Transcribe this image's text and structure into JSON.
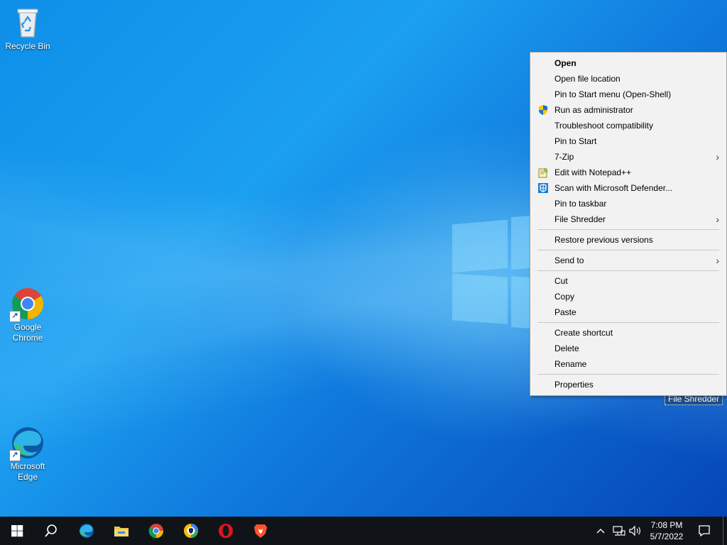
{
  "desktop": {
    "icons": [
      {
        "label": "Recycle Bin"
      },
      {
        "label_line1": "Google",
        "label_line2": "Chrome"
      },
      {
        "label_line1": "Microsoft",
        "label_line2": "Edge"
      }
    ]
  },
  "context_menu": {
    "items": [
      {
        "label": "Open",
        "bold": true
      },
      {
        "label": "Open file location"
      },
      {
        "label": "Pin to Start menu (Open-Shell)"
      },
      {
        "label": "Run as administrator",
        "icon": "uac-shield-icon"
      },
      {
        "label": "Troubleshoot compatibility"
      },
      {
        "label": "Pin to Start"
      },
      {
        "label": "7-Zip",
        "submenu": true
      },
      {
        "label": "Edit with Notepad++",
        "icon": "notepad-plus-plus-icon"
      },
      {
        "label": "Scan with Microsoft Defender...",
        "icon": "defender-icon"
      },
      {
        "label": "Pin to taskbar"
      },
      {
        "label": "File Shredder",
        "submenu": true
      },
      {
        "label": "Restore previous versions"
      },
      {
        "label": "Send to",
        "submenu": true
      },
      {
        "label": "Cut"
      },
      {
        "label": "Copy"
      },
      {
        "label": "Paste"
      },
      {
        "label": "Create shortcut"
      },
      {
        "label": "Delete"
      },
      {
        "label": "Rename"
      },
      {
        "label": "Properties"
      }
    ],
    "submenu_glyph": "›"
  },
  "tooltip": {
    "text": "File Shredder"
  },
  "taskbar": {
    "pinned": [
      "start-icon",
      "search-icon",
      "edge-icon",
      "file-explorer-icon",
      "chrome-icon",
      "private-browser-icon",
      "opera-icon",
      "brave-icon"
    ],
    "clock": {
      "time": "7:08 PM",
      "date": "5/7/2022"
    },
    "tray_chevron": "^"
  },
  "colors": {
    "taskbar": "#101418",
    "menu_bg": "#f2f2f2",
    "accent_blue": "#0078d7"
  }
}
